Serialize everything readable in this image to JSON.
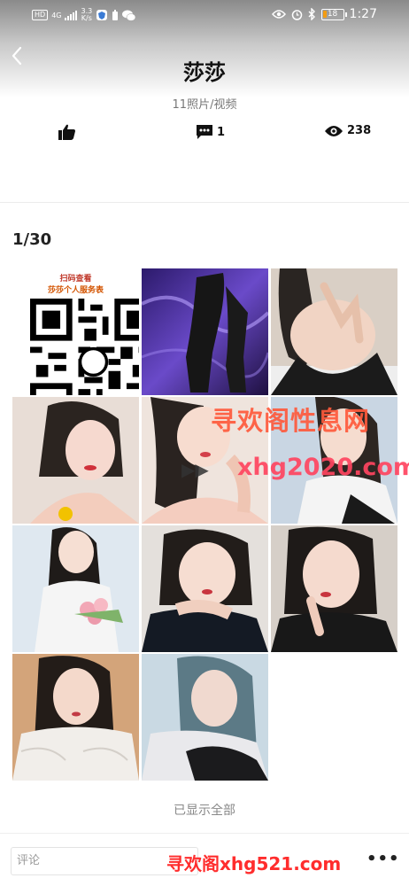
{
  "status_bar": {
    "network_badge": "HD",
    "network_type": "4G",
    "speed_value": "3.3",
    "speed_unit": "K/s",
    "battery": "18",
    "battery_fraction": 0.18,
    "time": "1:27",
    "icons": [
      "signal-icon",
      "shield-app-icon",
      "battery-saver-icon",
      "wechat-icon",
      "eye-comfort-icon",
      "alarm-icon",
      "bluetooth-icon"
    ]
  },
  "header": {
    "back_icon": "back-arrow-icon",
    "title": "莎莎",
    "subtitle": "11照片/视频"
  },
  "stats": {
    "like_icon": "thumbs-up-icon",
    "like_count": "",
    "comment_icon": "comment-icon",
    "comment_count": "1",
    "view_icon": "eye-icon",
    "view_count": "238"
  },
  "gallery": {
    "counter": "1/30",
    "qr_caption_1": "扫码查看",
    "qr_caption_2": "莎莎个人服务表",
    "thumbnails": [
      "qr-code-image",
      "purple-satin-photo",
      "selfie-black-top-photo",
      "selfie-red-lips-photo",
      "selfie-hand-cheek-photo",
      "selfie-white-top-photo",
      "white-shirt-flowers-photo",
      "hand-under-chin-photo",
      "finger-lips-photo",
      "lace-top-photo",
      "blue-hair-photo"
    ]
  },
  "watermarks": {
    "line1": "寻欢阁性息网",
    "line2": "xhg2020.com",
    "arrow": "▶▶",
    "bottom": "寻欢阁xhg521.com"
  },
  "footer": {
    "all_shown": "已显示全部",
    "comment_placeholder": "评论",
    "more_label": "•••"
  },
  "colors": {
    "accent_watermark": "#ff4560",
    "text_primary": "#111111",
    "text_secondary": "#777777"
  }
}
